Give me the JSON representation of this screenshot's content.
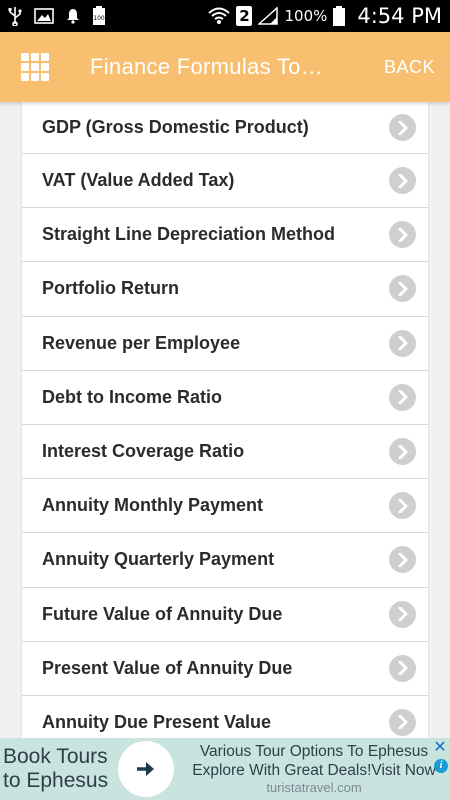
{
  "status_bar": {
    "battery_percent": "100%",
    "sim_slot": "2",
    "time": "4:54 PM",
    "icons": [
      "usb-icon",
      "image-icon",
      "notification-bell-icon",
      "battery-100-icon",
      "wifi-icon",
      "signal-icon",
      "battery-icon"
    ]
  },
  "app_bar": {
    "title": "Finance Formulas To…",
    "back_label": "BACK",
    "background": "#f7bf6f",
    "menu_icon": "grid-menu-icon"
  },
  "list": {
    "items": [
      {
        "label": "GDP (Gross Domestic Product)"
      },
      {
        "label": "VAT (Value Added Tax)"
      },
      {
        "label": "Straight Line Depreciation Method"
      },
      {
        "label": "Portfolio Return"
      },
      {
        "label": "Revenue per Employee"
      },
      {
        "label": "Debt to Income Ratio"
      },
      {
        "label": "Interest Coverage Ratio"
      },
      {
        "label": "Annuity Monthly Payment"
      },
      {
        "label": "Annuity Quarterly Payment"
      },
      {
        "label": "Future Value of Annuity Due"
      },
      {
        "label": "Present Value of Annuity Due"
      },
      {
        "label": "Annuity Due Present Value"
      }
    ],
    "item_icon": "chevron-right-icon"
  },
  "ad": {
    "title": "Book Tours to Ephesus",
    "body": "Various Tour Options To Ephesus Explore With Great Deals!Visit Now",
    "domain": "turistatravel.com",
    "close_symbol": "✕",
    "info_symbol": "i",
    "background": "#c9e4df"
  }
}
